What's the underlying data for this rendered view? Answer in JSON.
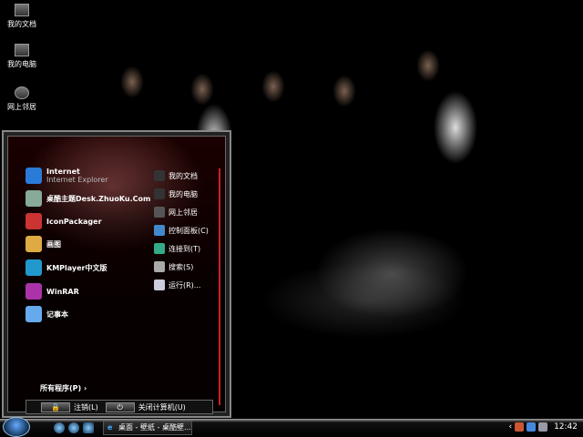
{
  "desktop": {
    "icons": [
      {
        "label": "我的文档"
      },
      {
        "label": "我的电脑"
      },
      {
        "label": "网上邻居"
      }
    ]
  },
  "start_menu": {
    "left_items": [
      {
        "label": "Internet",
        "sub": "Internet Explorer",
        "icon": "internet-explorer-icon",
        "color": "#2a7ad8"
      },
      {
        "label": "桌酷主题Desk.ZhuoKu.Com",
        "icon": "zhuoku-theme-icon",
        "color": "#8a9"
      },
      {
        "label": "IconPackager",
        "icon": "iconpackager-icon",
        "color": "#c33"
      },
      {
        "label": "画图",
        "icon": "paint-icon",
        "color": "#da4"
      },
      {
        "label": "KMPlayer中文版",
        "icon": "kmplayer-icon",
        "color": "#29c"
      },
      {
        "label": "WinRAR",
        "icon": "winrar-icon",
        "color": "#a3a"
      },
      {
        "label": "记事本",
        "icon": "notepad-icon",
        "color": "#6ae"
      }
    ],
    "right_items": [
      {
        "label": "我的文档",
        "icon": "my-documents-icon",
        "color": "#333"
      },
      {
        "label": "我的电脑",
        "icon": "my-computer-icon",
        "color": "#333"
      },
      {
        "label": "网上邻居",
        "icon": "network-icon",
        "color": "#555"
      },
      {
        "label": "控制面板(C)",
        "icon": "control-panel-icon",
        "color": "#48c"
      },
      {
        "label": "连接到(T)",
        "icon": "connect-icon",
        "color": "#3a8"
      },
      {
        "label": "搜索(S)",
        "icon": "search-icon",
        "color": "#aaa"
      },
      {
        "label": "运行(R)...",
        "icon": "run-icon",
        "color": "#ccd"
      }
    ],
    "all_programs": "所有程序(P)",
    "logoff": "注销(L)",
    "shutdown": "关闭计算机(U)"
  },
  "taskbar": {
    "task": "桌面 - 壁纸 - 桌酷壁...",
    "clock": "12:42"
  }
}
